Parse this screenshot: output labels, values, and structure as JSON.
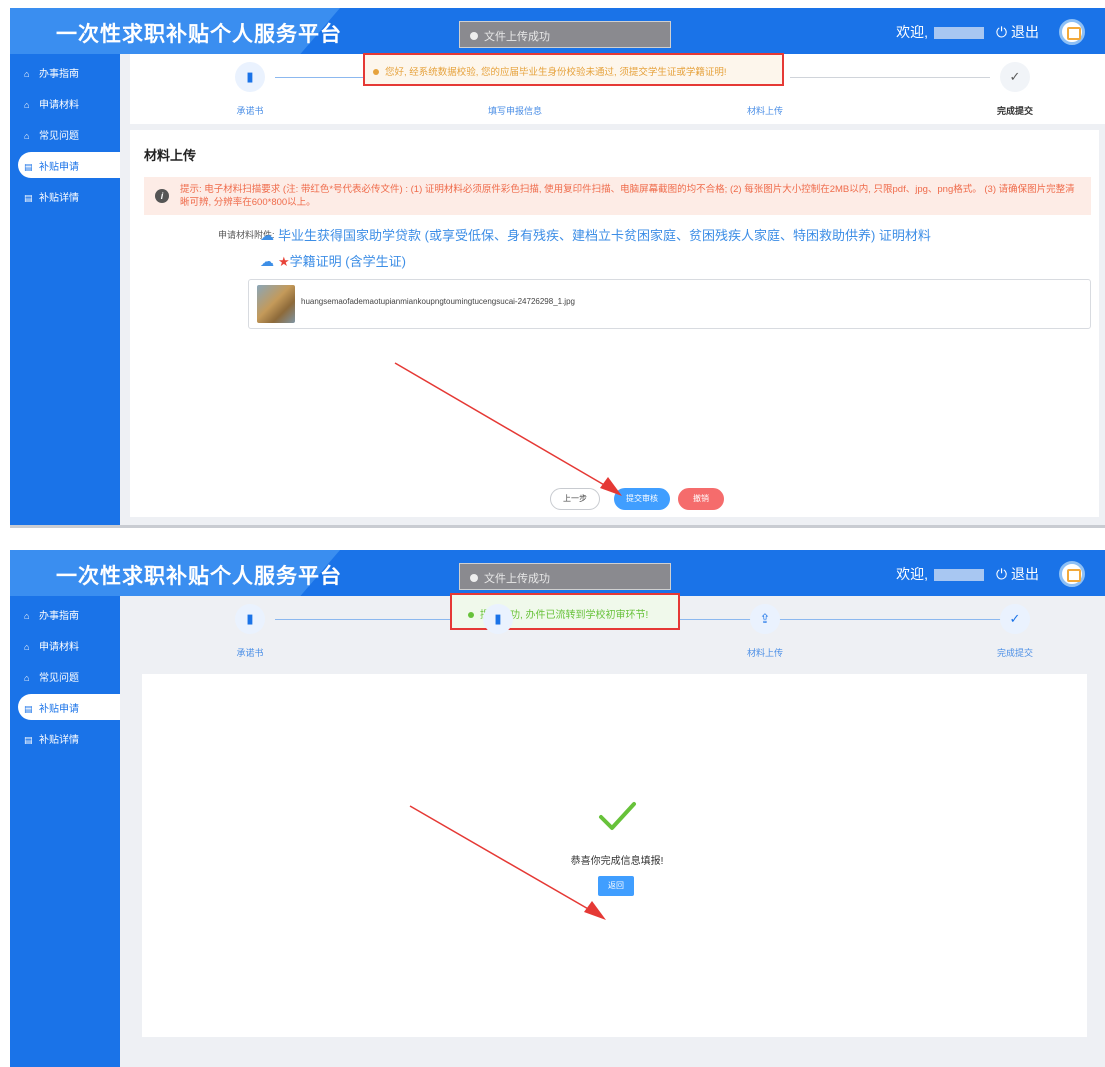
{
  "platform_title": "一次性求职补贴个人服务平台",
  "topbar_notice": "文件上传成功",
  "welcome_label": "欢迎,",
  "logout_label": "退出",
  "sidebar": {
    "items": [
      {
        "label": "办事指南",
        "icon": "home-icon"
      },
      {
        "label": "申请材料",
        "icon": "home-icon"
      },
      {
        "label": "常见问题",
        "icon": "home-icon"
      },
      {
        "label": "补贴申请",
        "icon": "document-icon",
        "active": true
      },
      {
        "label": "补贴详情",
        "icon": "document-icon"
      }
    ]
  },
  "steps": [
    {
      "label": "承诺书",
      "icon": "clipboard-icon"
    },
    {
      "label": "填写申报信息",
      "icon": "clipboard-icon"
    },
    {
      "label": "材料上传",
      "icon": "upload-icon"
    },
    {
      "label": "完成提交",
      "icon": "check-icon"
    }
  ],
  "upload_page": {
    "section_title": "材料上传",
    "tip": "提示: 电子材料扫描要求 (注: 带红色*号代表必传文件) : (1) 证明材料必须原件彩色扫描, 使用复印件扫描、电脑屏幕截图的均不合格; (2) 每张图片大小控制在2MB以内, 只限pdf、jpg、png格式。 (3) 请确保图片完整清晰可辨, 分辨率在600*800以上。",
    "attachments_label": "申请材料附件:",
    "attachment_1": "毕业生获得国家助学贷款 (或享受低保、身有残疾、建档立卡贫困家庭、贫困残疾人家庭、特困救助供养) 证明材料",
    "attachment_2_required_mark": "★",
    "attachment_2": "学籍证明 (含学生证)",
    "file_name": "huangsemaofademaotupianmiankoupngtoumingtucengsucai-24726298_1.jpg",
    "prev_button": "上一步",
    "submit_button": "提交审核",
    "revoke_button": "撤销",
    "warning_toast": "您好, 经系统数据校验, 您的应届毕业生身份校验未通过, 须提交学生证或学籍证明!"
  },
  "complete_page": {
    "success_toast": "提交成功, 办件已流转到学校初审环节!",
    "congrats_text": "恭喜你完成信息填报!",
    "back_button": "返回"
  },
  "colors": {
    "primary": "#1a73e8",
    "warning": "#e6a23c",
    "success": "#67c23a",
    "danger": "#f56c6c",
    "highlight_box": "#e53935"
  }
}
